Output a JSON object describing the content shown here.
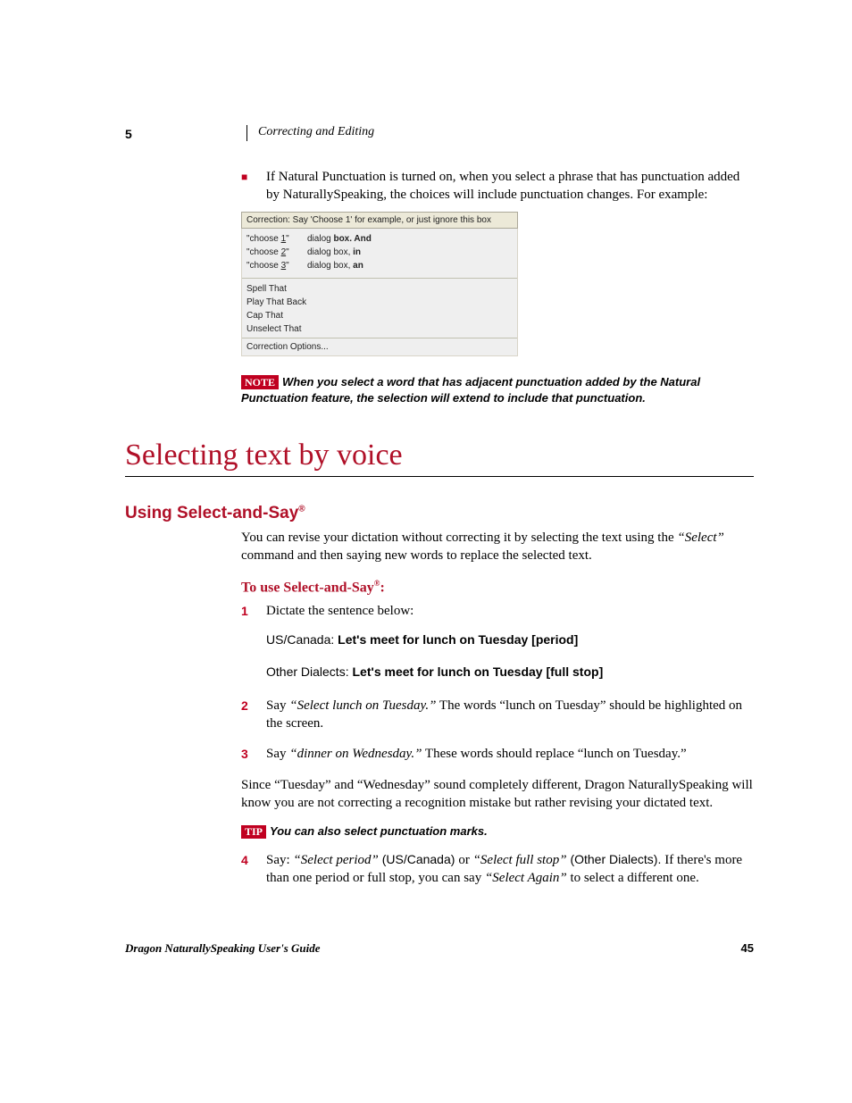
{
  "header": {
    "chapter_num": "5",
    "chapter_title": "Correcting and Editing"
  },
  "intro_bullet": "If Natural Punctuation is turned on, when you select a phrase that has punctuation added by NaturallySpeaking, the choices will include punctuation changes. For example:",
  "dialog": {
    "header": "Correction: Say 'Choose 1' for example, or just ignore this box",
    "rows": [
      {
        "cmd_pre": "\"choose ",
        "cmd_u": "1",
        "cmd_post": "\"",
        "txt_pre": "dialog ",
        "txt_b": "box. And",
        "txt_post": ""
      },
      {
        "cmd_pre": "\"choose ",
        "cmd_u": "2",
        "cmd_post": "\"",
        "txt_pre": "dialog box, ",
        "txt_b": "in",
        "txt_post": ""
      },
      {
        "cmd_pre": "\"choose ",
        "cmd_u": "3",
        "cmd_post": "\"",
        "txt_pre": "dialog box, ",
        "txt_b": "an",
        "txt_post": ""
      }
    ],
    "actions": [
      {
        "pre": "",
        "u": "S",
        "post": "pell That"
      },
      {
        "pre": "",
        "u": "P",
        "post": "lay That Back"
      },
      {
        "pre": "C",
        "u": "a",
        "post": "p That"
      },
      {
        "pre": "",
        "u": "U",
        "post": "nselect That"
      }
    ],
    "options": {
      "pre": "Correction ",
      "u": "O",
      "post": "ptions..."
    }
  },
  "note": {
    "badge": "NOTE",
    "text": "When you select a word that has adjacent punctuation added by the Natural Punctuation feature, the selection will extend to include that punctuation."
  },
  "main_title": "Selecting text by voice",
  "sub_title": "Using Select-and-Say",
  "sub_para": {
    "p1a": "You can revise your dictation without correcting it by selecting the text using the ",
    "p1b": "“Select”",
    "p1c": " command and then saying new words to replace the selected text."
  },
  "proc_title": "To use Select-and-Say",
  "steps": {
    "s1": "Dictate the sentence below:",
    "ex1_label": "US/Canada: ",
    "ex1_text": "Let's meet for lunch on Tuesday [period]",
    "ex2_label": "Other Dialects: ",
    "ex2_text": "Let's meet for lunch on Tuesday [full stop]",
    "s2a": "Say ",
    "s2b": "“Select lunch on Tuesday.”",
    "s2c": " The words “lunch on Tuesday” should be highlighted on the screen.",
    "s3a": "Say ",
    "s3b": "“dinner on Wednesday.”",
    "s3c": " These words should replace “lunch on Tuesday.”",
    "after": "Since “Tuesday” and “Wednesday” sound completely different, Dragon NaturallySpeaking will know you are not correcting a recognition mistake but rather revising your dictated text.",
    "s4a": "Say: ",
    "s4b": "“Select period”",
    "s4c": " (US/Canada) ",
    "s4d": "or ",
    "s4e": "“Select full stop”",
    "s4f": " (Other Dialects). ",
    "s4g": "If there's more than one period or full stop, you can say ",
    "s4h": "“Select Again”",
    "s4i": " to select a different one."
  },
  "tip": {
    "badge": "TIP",
    "text": "You can also select punctuation marks."
  },
  "footer": {
    "guide": "Dragon NaturallySpeaking User's Guide",
    "page": "45"
  }
}
